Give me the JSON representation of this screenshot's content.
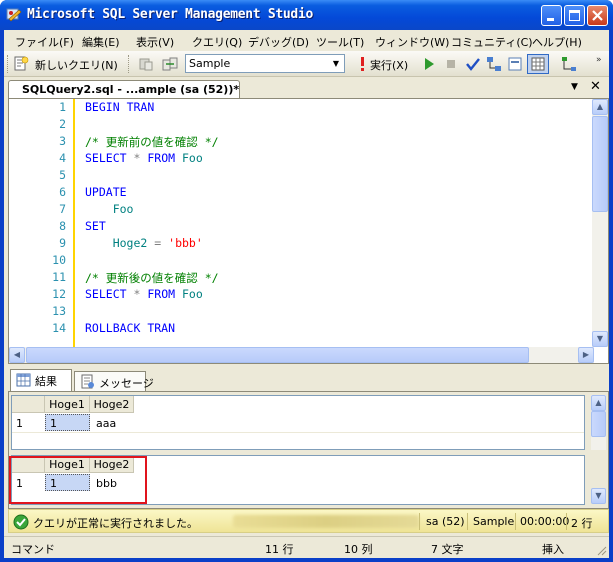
{
  "window": {
    "title": "Microsoft SQL Server Management Studio"
  },
  "menu": {
    "items": [
      "ファイル(F)",
      "編集(E)",
      "表示(V)",
      "クエリ(Q)",
      "デバッグ(D)",
      "ツール(T)",
      "ウィンドウ(W)",
      "コミュニティ(C)",
      "ヘルプ(H)"
    ]
  },
  "toolbar": {
    "new_query_label": "新しいクエリ(N)",
    "database_value": "Sample",
    "execute_label": "実行(X)"
  },
  "document_tab": {
    "label": "SQLQuery2.sql - ...ample (sa (52))*"
  },
  "editor": {
    "lines": [
      {
        "n": "1",
        "text": "BEGIN TRAN"
      },
      {
        "n": "2",
        "text": ""
      },
      {
        "n": "3",
        "text": "/* 更新前の値を確認 */"
      },
      {
        "n": "4",
        "text": "SELECT * FROM Foo"
      },
      {
        "n": "5",
        "text": ""
      },
      {
        "n": "6",
        "text": "UPDATE"
      },
      {
        "n": "7",
        "text": "    Foo"
      },
      {
        "n": "8",
        "text": "SET"
      },
      {
        "n": "9",
        "text": "    Hoge2 = 'bbb'"
      },
      {
        "n": "10",
        "text": ""
      },
      {
        "n": "11",
        "text": "/* 更新後の値を確認 */"
      },
      {
        "n": "12",
        "text": "SELECT * FROM Foo"
      },
      {
        "n": "13",
        "text": ""
      },
      {
        "n": "14",
        "text": "ROLLBACK TRAN"
      }
    ]
  },
  "result_tabs": {
    "results_label": "結果",
    "messages_label": "メッセージ"
  },
  "grid1": {
    "headers": [
      "Hoge1",
      "Hoge2"
    ],
    "rows": [
      {
        "rownum": "1",
        "cells": [
          "1",
          "aaa"
        ]
      }
    ]
  },
  "grid2": {
    "headers": [
      "Hoge1",
      "Hoge2"
    ],
    "rows": [
      {
        "rownum": "1",
        "cells": [
          "1",
          "bbb"
        ]
      }
    ]
  },
  "status": {
    "message": "クエリが正常に実行されました。",
    "user": "sa (52)",
    "database": "Sample",
    "elapsed": "00:00:00",
    "rows": "2 行"
  },
  "bottom": {
    "mode": "コマンド",
    "line": "11 行",
    "column": "10 列",
    "chars": "7 文字",
    "insert": "挿入"
  },
  "colors": {
    "title_bar": "#0a5de0",
    "highlight_border": "#e0141d",
    "status_bar": "#efe496"
  }
}
